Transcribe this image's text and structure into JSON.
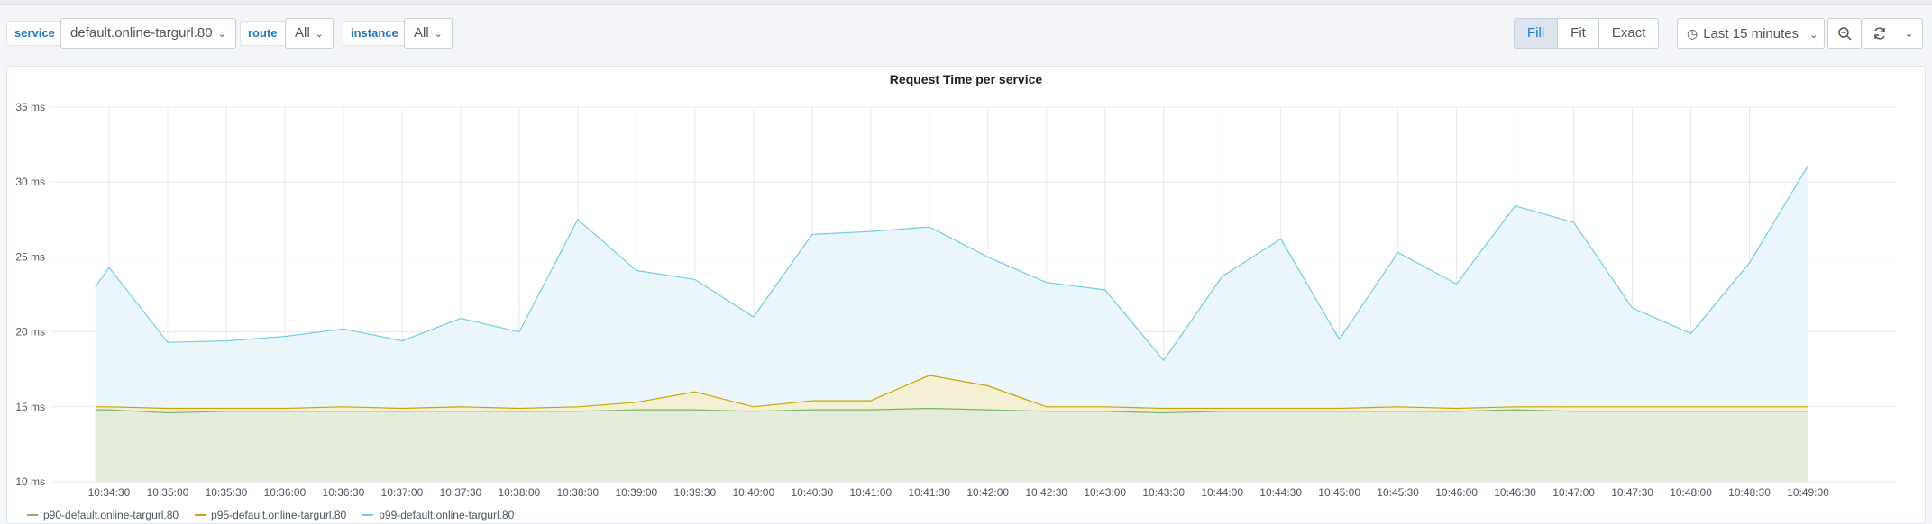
{
  "toolbar": {
    "service_label": "service",
    "service_value": "default.online-targurl.80",
    "route_label": "route",
    "route_value": "All",
    "instance_label": "instance",
    "instance_value": "All",
    "fill_label": "Fill",
    "fit_label": "Fit",
    "exact_label": "Exact",
    "time_range": "Last 15 minutes"
  },
  "icons": {
    "chevron": "chevron-down-icon",
    "clock": "clock-icon",
    "zoom_out": "zoom-out-icon",
    "refresh": "refresh-icon"
  },
  "chart_data": {
    "type": "area",
    "title": "Request Time per service",
    "xlabel": "",
    "ylabel": "",
    "ylim": [
      10,
      35
    ],
    "yticks": [
      10,
      15,
      20,
      25,
      30,
      35
    ],
    "ytick_labels": [
      "10 ms",
      "15 ms",
      "20 ms",
      "25 ms",
      "30 ms",
      "35 ms"
    ],
    "x_start": "10:34:00",
    "x_end": "10:49:45",
    "xtick_labels": [
      "10:34:30",
      "10:35:00",
      "10:35:30",
      "10:36:00",
      "10:36:30",
      "10:37:00",
      "10:37:30",
      "10:38:00",
      "10:38:30",
      "10:39:00",
      "10:39:30",
      "10:40:00",
      "10:40:30",
      "10:41:00",
      "10:41:30",
      "10:42:00",
      "10:42:30",
      "10:43:00",
      "10:43:30",
      "10:44:00",
      "10:44:30",
      "10:45:00",
      "10:45:30",
      "10:46:00",
      "10:46:30",
      "10:47:00",
      "10:47:30",
      "10:48:00",
      "10:48:30",
      "10:49:00"
    ],
    "grid": true,
    "legend_position": "bottom-left",
    "series": [
      {
        "name": "p90-default.online-targurl.80",
        "color": "#7eb26d",
        "fill": "#e3ecdd",
        "points": [
          [
            "10:34:23",
            14.8
          ],
          [
            "10:34:30",
            14.8
          ],
          [
            "10:35:00",
            14.6
          ],
          [
            "10:35:30",
            14.7
          ],
          [
            "10:36:00",
            14.7
          ],
          [
            "10:36:30",
            14.7
          ],
          [
            "10:37:00",
            14.7
          ],
          [
            "10:37:30",
            14.7
          ],
          [
            "10:38:00",
            14.7
          ],
          [
            "10:38:30",
            14.7
          ],
          [
            "10:39:00",
            14.8
          ],
          [
            "10:39:30",
            14.8
          ],
          [
            "10:40:00",
            14.7
          ],
          [
            "10:40:30",
            14.8
          ],
          [
            "10:41:00",
            14.8
          ],
          [
            "10:41:30",
            14.9
          ],
          [
            "10:42:00",
            14.8
          ],
          [
            "10:42:30",
            14.7
          ],
          [
            "10:43:00",
            14.7
          ],
          [
            "10:43:30",
            14.6
          ],
          [
            "10:44:00",
            14.7
          ],
          [
            "10:44:30",
            14.7
          ],
          [
            "10:45:00",
            14.7
          ],
          [
            "10:45:30",
            14.7
          ],
          [
            "10:46:00",
            14.7
          ],
          [
            "10:46:30",
            14.8
          ],
          [
            "10:47:00",
            14.7
          ],
          [
            "10:47:30",
            14.7
          ],
          [
            "10:48:00",
            14.7
          ],
          [
            "10:48:30",
            14.7
          ],
          [
            "10:49:00",
            14.7
          ]
        ]
      },
      {
        "name": "p95-default.online-targurl.80",
        "color": "#cca300",
        "fill": "#f4f0d6",
        "points": [
          [
            "10:34:23",
            15.0
          ],
          [
            "10:34:30",
            15.0
          ],
          [
            "10:35:00",
            14.9
          ],
          [
            "10:35:30",
            14.9
          ],
          [
            "10:36:00",
            14.9
          ],
          [
            "10:36:30",
            15.0
          ],
          [
            "10:37:00",
            14.9
          ],
          [
            "10:37:30",
            15.0
          ],
          [
            "10:38:00",
            14.9
          ],
          [
            "10:38:30",
            15.0
          ],
          [
            "10:39:00",
            15.3
          ],
          [
            "10:39:30",
            16.0
          ],
          [
            "10:40:00",
            15.0
          ],
          [
            "10:40:30",
            15.4
          ],
          [
            "10:41:00",
            15.4
          ],
          [
            "10:41:30",
            17.1
          ],
          [
            "10:42:00",
            16.4
          ],
          [
            "10:42:30",
            15.0
          ],
          [
            "10:43:00",
            15.0
          ],
          [
            "10:43:30",
            14.9
          ],
          [
            "10:44:00",
            14.9
          ],
          [
            "10:44:30",
            14.9
          ],
          [
            "10:45:00",
            14.9
          ],
          [
            "10:45:30",
            15.0
          ],
          [
            "10:46:00",
            14.9
          ],
          [
            "10:46:30",
            15.0
          ],
          [
            "10:47:00",
            15.0
          ],
          [
            "10:47:30",
            15.0
          ],
          [
            "10:48:00",
            15.0
          ],
          [
            "10:48:30",
            15.0
          ],
          [
            "10:49:00",
            15.0
          ]
        ]
      },
      {
        "name": "p99-default.online-targurl.80",
        "color": "#6ed0e0",
        "fill": "#eaf6f9",
        "points": [
          [
            "10:34:23",
            23.0
          ],
          [
            "10:34:30",
            24.3
          ],
          [
            "10:35:00",
            19.3
          ],
          [
            "10:35:30",
            19.4
          ],
          [
            "10:36:00",
            19.7
          ],
          [
            "10:36:30",
            20.2
          ],
          [
            "10:37:00",
            19.4
          ],
          [
            "10:37:30",
            20.9
          ],
          [
            "10:38:00",
            20.0
          ],
          [
            "10:38:30",
            27.5
          ],
          [
            "10:39:00",
            24.1
          ],
          [
            "10:39:30",
            23.5
          ],
          [
            "10:40:00",
            21.0
          ],
          [
            "10:40:30",
            26.5
          ],
          [
            "10:41:00",
            26.7
          ],
          [
            "10:41:30",
            27.0
          ],
          [
            "10:42:00",
            25.0
          ],
          [
            "10:42:30",
            23.3
          ],
          [
            "10:43:00",
            22.8
          ],
          [
            "10:43:30",
            18.1
          ],
          [
            "10:44:00",
            23.7
          ],
          [
            "10:44:30",
            26.2
          ],
          [
            "10:45:00",
            19.5
          ],
          [
            "10:45:30",
            25.3
          ],
          [
            "10:46:00",
            23.2
          ],
          [
            "10:46:30",
            28.4
          ],
          [
            "10:47:00",
            27.3
          ],
          [
            "10:47:30",
            21.6
          ],
          [
            "10:48:00",
            19.9
          ],
          [
            "10:48:30",
            24.6
          ],
          [
            "10:49:00",
            31.1
          ]
        ]
      }
    ]
  }
}
